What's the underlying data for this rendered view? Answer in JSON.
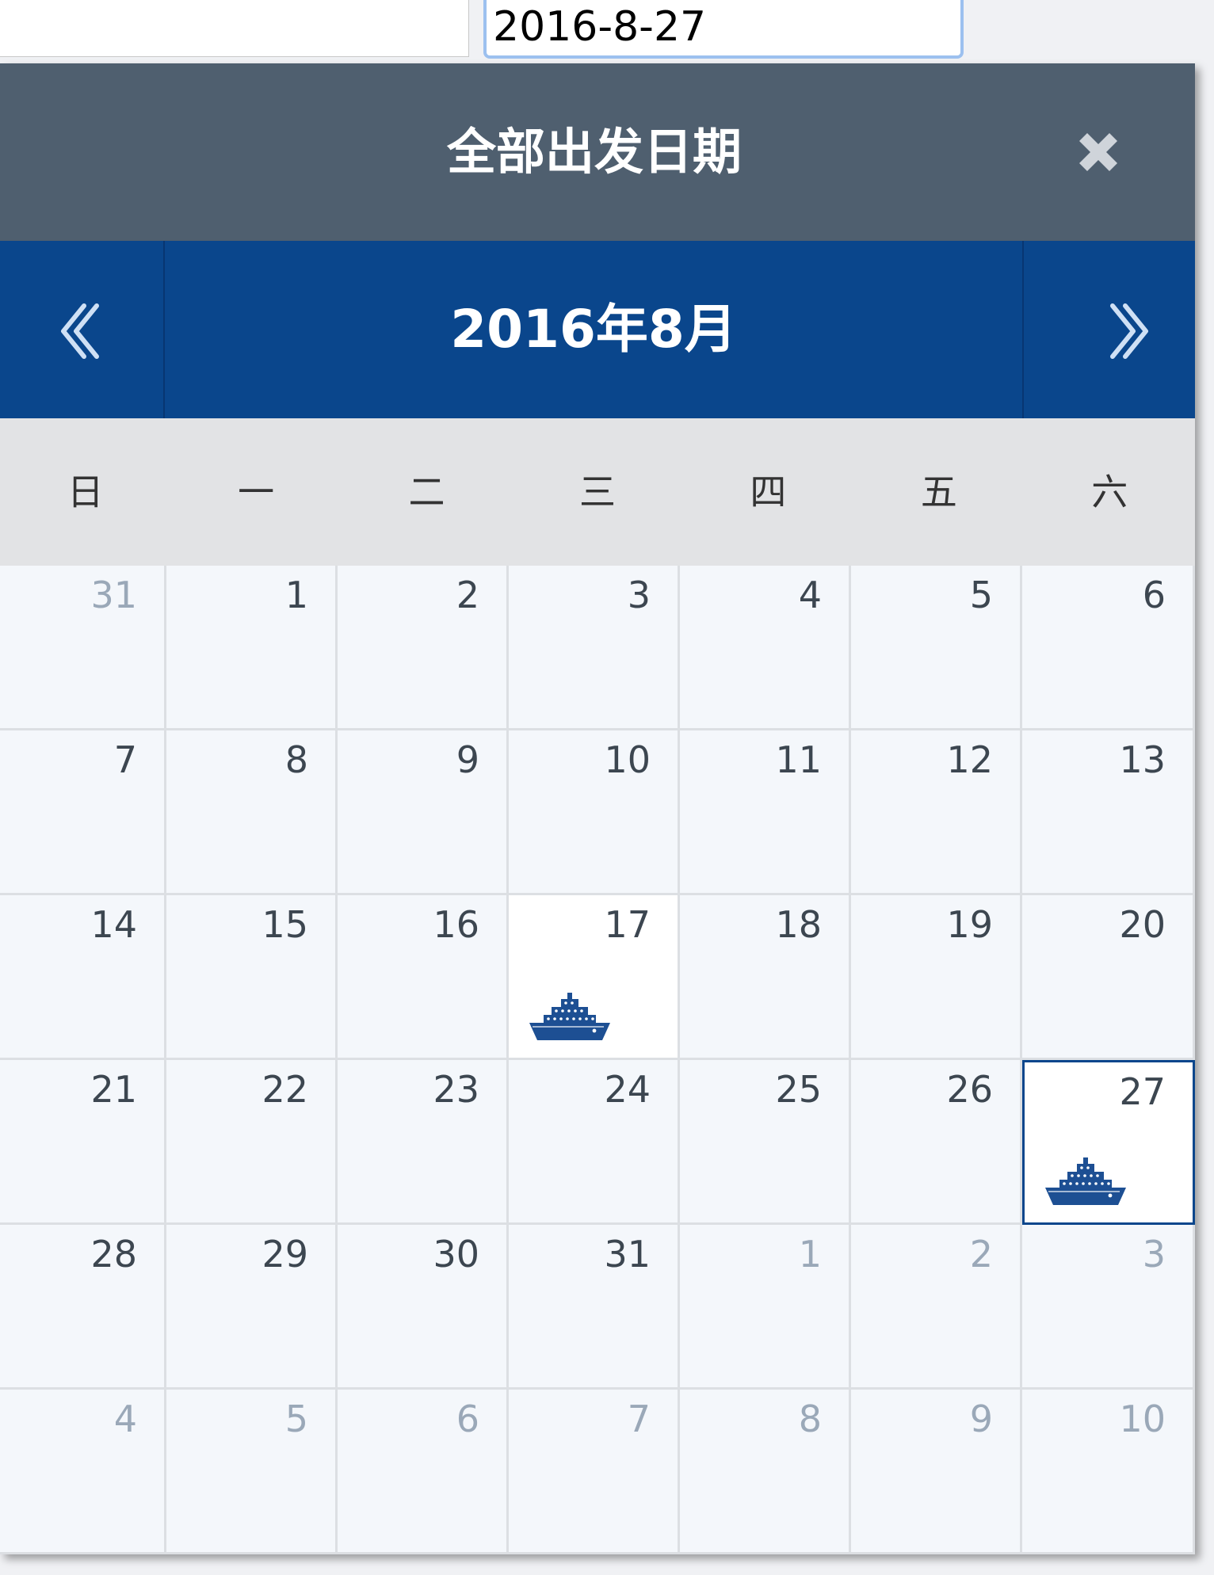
{
  "search": {
    "date_value": "2016-8-27"
  },
  "calendar": {
    "title": "全部出发日期",
    "month_label": "2016年8月",
    "weekdays": [
      "日",
      "一",
      "二",
      "三",
      "四",
      "五",
      "六"
    ],
    "accent_color": "#0a468c",
    "header_color": "#4f5f6f",
    "icons": {
      "close": "close-icon",
      "prev": "double-chevron-left-icon",
      "next": "double-chevron-right-icon",
      "departure": "cruise-ship-icon"
    },
    "weeks": [
      [
        {
          "day": "31",
          "muted": true
        },
        {
          "day": "1"
        },
        {
          "day": "2"
        },
        {
          "day": "3"
        },
        {
          "day": "4"
        },
        {
          "day": "5"
        },
        {
          "day": "6"
        }
      ],
      [
        {
          "day": "7"
        },
        {
          "day": "8"
        },
        {
          "day": "9"
        },
        {
          "day": "10"
        },
        {
          "day": "11"
        },
        {
          "day": "12"
        },
        {
          "day": "13"
        }
      ],
      [
        {
          "day": "14"
        },
        {
          "day": "15"
        },
        {
          "day": "16"
        },
        {
          "day": "17",
          "departure": true
        },
        {
          "day": "18"
        },
        {
          "day": "19"
        },
        {
          "day": "20"
        }
      ],
      [
        {
          "day": "21"
        },
        {
          "day": "22"
        },
        {
          "day": "23"
        },
        {
          "day": "24"
        },
        {
          "day": "25"
        },
        {
          "day": "26"
        },
        {
          "day": "27",
          "departure": true,
          "selected": true
        }
      ],
      [
        {
          "day": "28"
        },
        {
          "day": "29"
        },
        {
          "day": "30"
        },
        {
          "day": "31"
        },
        {
          "day": "1",
          "muted": true
        },
        {
          "day": "2",
          "muted": true
        },
        {
          "day": "3",
          "muted": true
        }
      ],
      [
        {
          "day": "4",
          "muted": true
        },
        {
          "day": "5",
          "muted": true
        },
        {
          "day": "6",
          "muted": true
        },
        {
          "day": "7",
          "muted": true
        },
        {
          "day": "8",
          "muted": true
        },
        {
          "day": "9",
          "muted": true
        },
        {
          "day": "10",
          "muted": true
        }
      ]
    ]
  }
}
